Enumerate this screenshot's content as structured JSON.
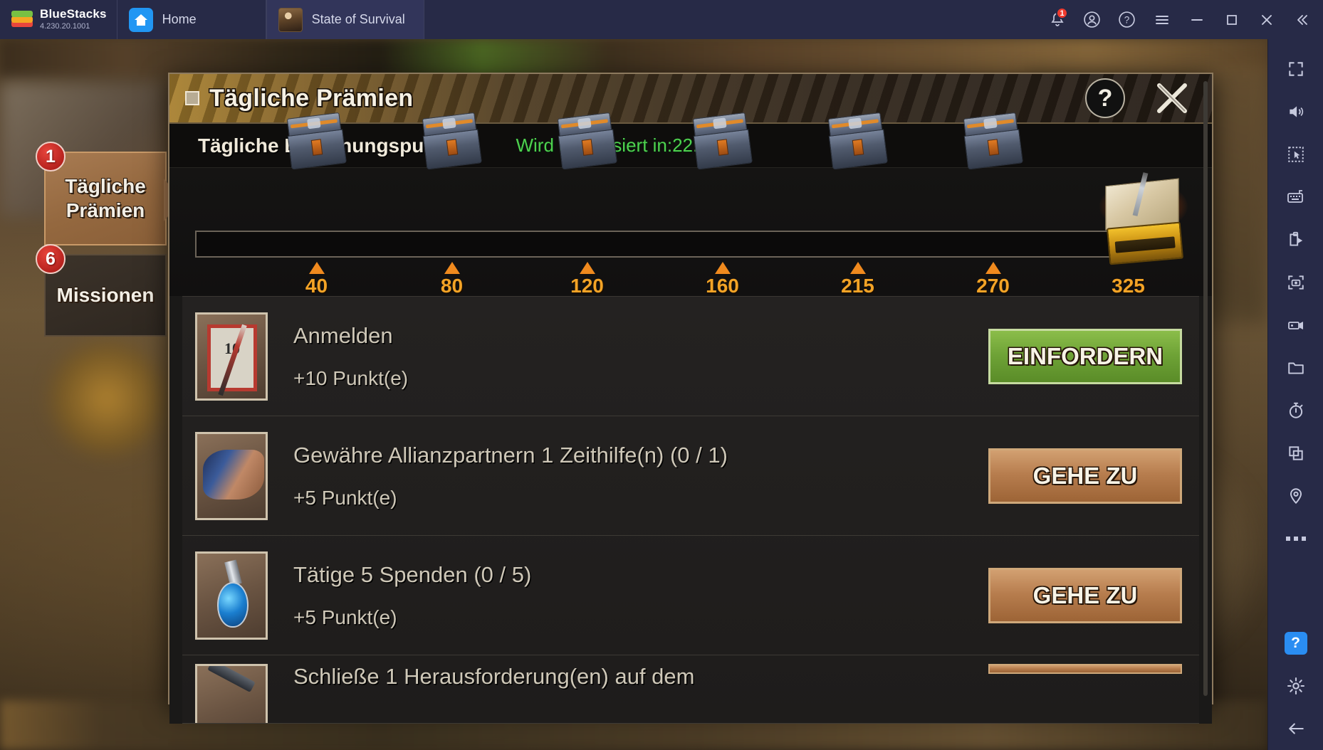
{
  "titlebar": {
    "brand_name": "BlueStacks",
    "version": "4.230.20.1001",
    "tabs": [
      {
        "label": "Home",
        "icon": "home-icon"
      },
      {
        "label": "State of Survival",
        "icon": "game-thumbnail"
      }
    ],
    "icons": [
      {
        "name": "notifications-bell-icon",
        "badge": "1"
      },
      {
        "name": "account-icon",
        "badge": ""
      },
      {
        "name": "help-icon",
        "badge": ""
      },
      {
        "name": "menu-icon",
        "badge": ""
      },
      {
        "name": "minimize-icon",
        "badge": ""
      },
      {
        "name": "maximize-icon",
        "badge": ""
      },
      {
        "name": "close-icon",
        "badge": ""
      },
      {
        "name": "collapse-icon",
        "badge": ""
      }
    ]
  },
  "sidebar": {
    "items": [
      "fullscreen-icon",
      "volume-icon",
      "cursor-select-icon",
      "keyboard-icon",
      "macro-script-icon",
      "screenshot-icon",
      "record-video-icon",
      "folder-icon",
      "timer-icon",
      "multi-instance-icon",
      "location-icon",
      "more-icon"
    ],
    "help_label": "?",
    "bottom_items": [
      "settings-gear-icon",
      "back-arrow-icon"
    ]
  },
  "left_tabs": [
    {
      "label": "Tägliche Prämien",
      "badge": "1",
      "active": true
    },
    {
      "label": "Missionen",
      "badge": "6",
      "active": false
    }
  ],
  "modal": {
    "title": "Tägliche Prämien",
    "help_label": "?",
    "points_label": "Tägliche Belohnungspunkte0",
    "refresh_timer": "Wird aktualisiert in:22:07:37",
    "progress": {
      "milestones": [
        "40",
        "80",
        "120",
        "160",
        "215",
        "270",
        "325"
      ],
      "filled_percent": 0
    },
    "tasks": [
      {
        "icon": "calendar-icon",
        "title": "Anmelden",
        "points": "+10 Punkt(e)",
        "button": "EINFORDERN",
        "button_type": "claim"
      },
      {
        "icon": "handshake-icon",
        "title": "Gewähre Allianzpartnern 1 Zeithilfe(n) (0 / 1)",
        "points": "+5 Punkt(e)",
        "button": "GEHE ZU",
        "button_type": "goto"
      },
      {
        "icon": "flask-icon",
        "title": "Tätige 5 Spenden (0 / 5)",
        "points": "+5 Punkt(e)",
        "button": "GEHE ZU",
        "button_type": "goto"
      },
      {
        "icon": "weapon-icon",
        "title": "Schließe 1 Herausforderung(en) auf dem",
        "points": "",
        "button": "",
        "button_type": "goto"
      }
    ]
  },
  "colors": {
    "titlebar_bg": "#272a47",
    "accent_blue": "#2a8df2",
    "badge_red": "#f03a2e",
    "timer_green": "#4fd04f",
    "milestone_orange": "#f3a326",
    "claim_green": "#6ea236",
    "goto_brown": "#b77d4e"
  }
}
